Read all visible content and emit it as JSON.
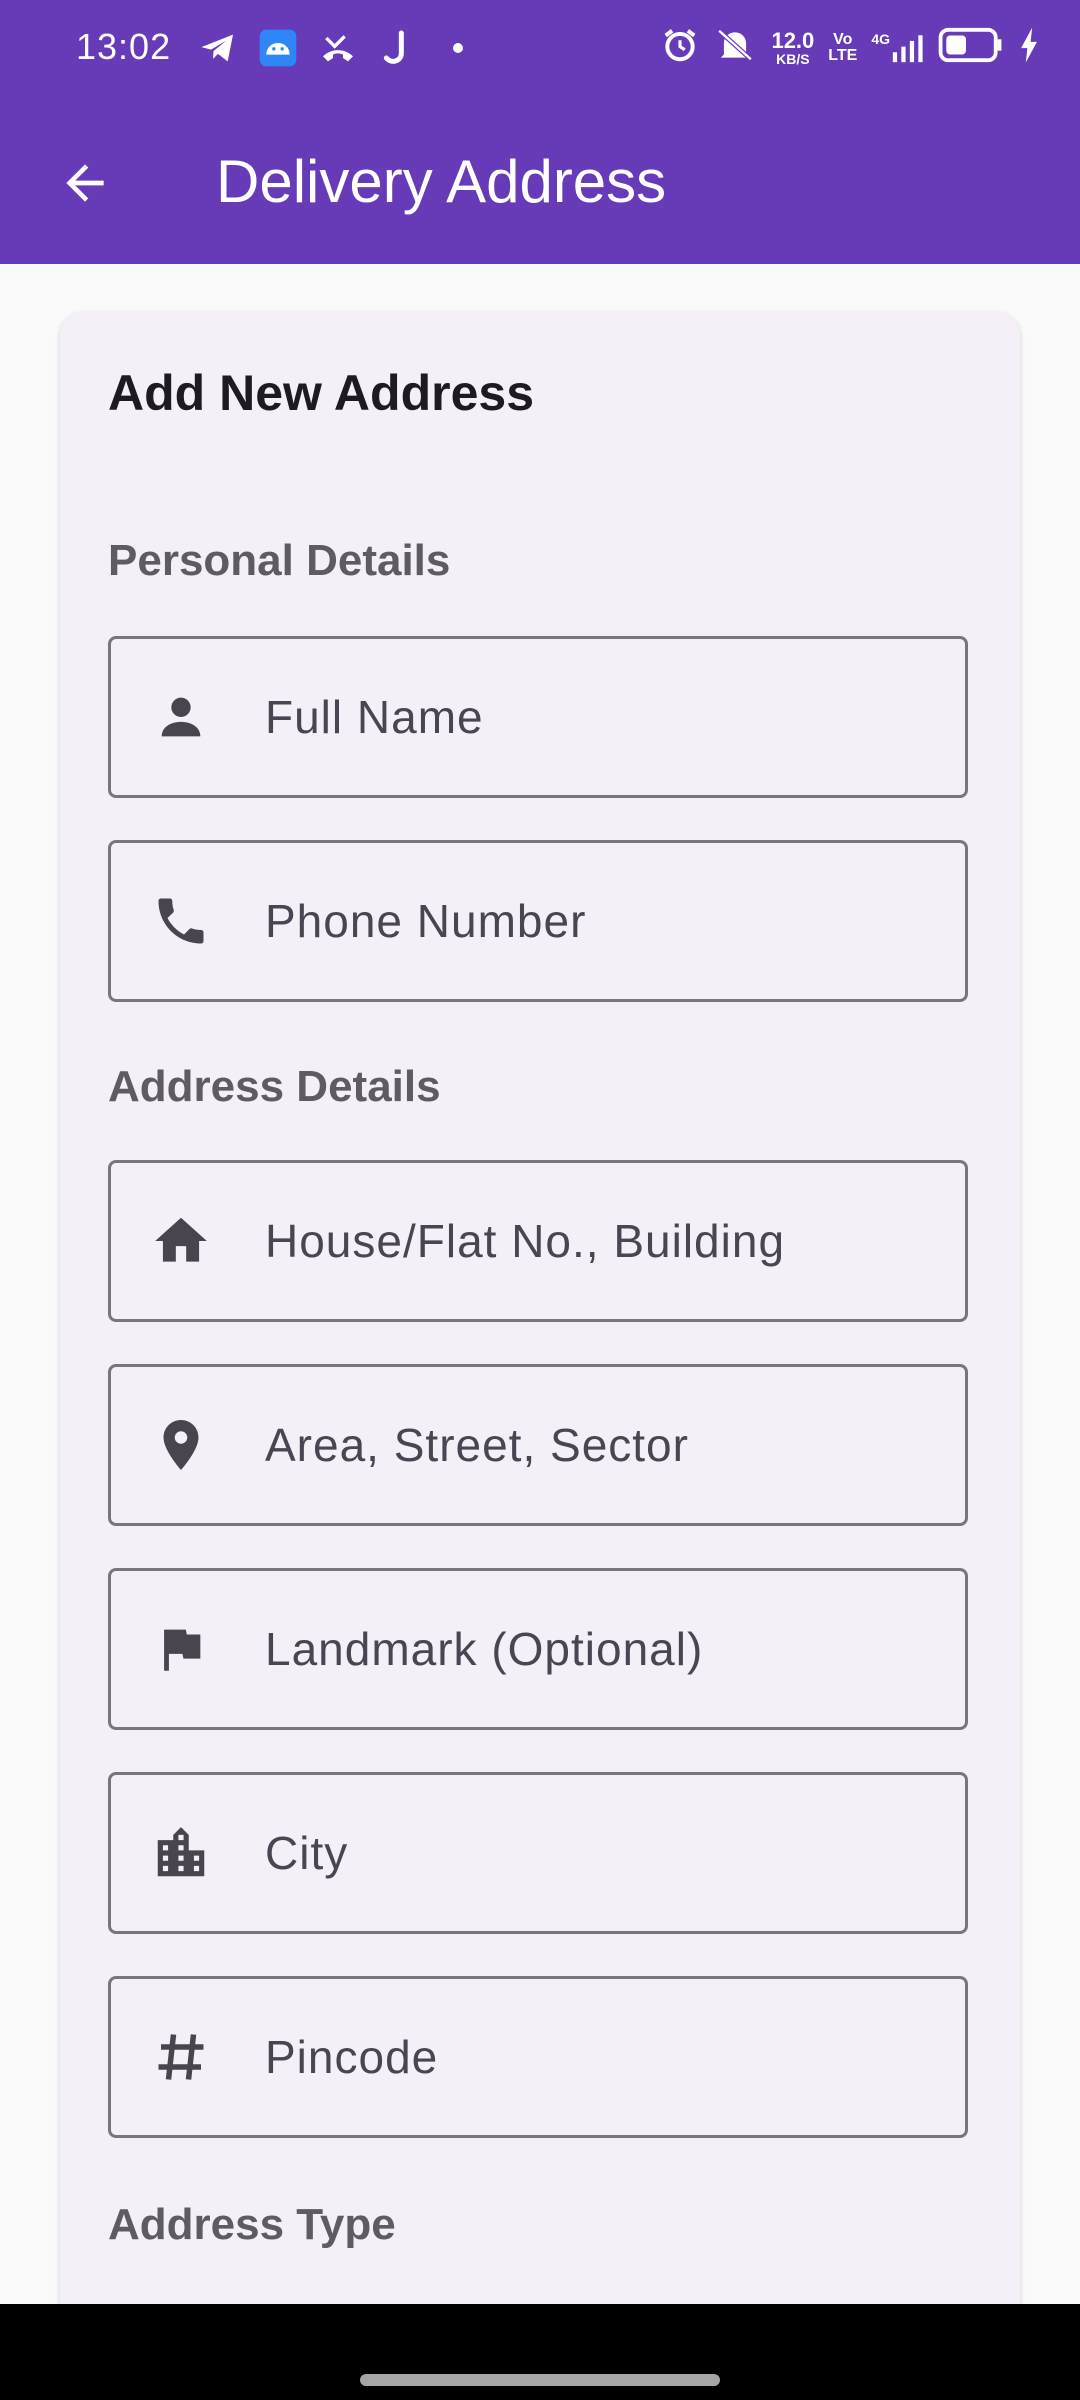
{
  "status_bar": {
    "time": "13:02",
    "network_speed_value": "12.0",
    "network_speed_unit": "KB/S",
    "volte_top": "Vo",
    "volte_bottom": "LTE",
    "network_type": "4G",
    "icons": [
      "telegram-icon",
      "android-icon",
      "missed-call-icon",
      "j-app-icon",
      "dot-icon",
      "alarm-icon",
      "mute-icon",
      "signal-icon",
      "battery-icon",
      "charging-icon"
    ],
    "battery_level": 0.45
  },
  "app_bar": {
    "title": "Delivery Address",
    "back_icon": "arrow-back-icon",
    "background": "#673ab7"
  },
  "card": {
    "title": "Add New Address",
    "sections": {
      "personal": "Personal Details",
      "address": "Address Details",
      "type": "Address Type"
    },
    "fields": {
      "full_name": {
        "placeholder": "Full Name",
        "icon": "person-icon"
      },
      "phone": {
        "placeholder": "Phone Number",
        "icon": "phone-icon"
      },
      "house": {
        "placeholder": "House/Flat No., Building",
        "icon": "home-icon"
      },
      "area": {
        "placeholder": "Area, Street, Sector",
        "icon": "location-pin-icon"
      },
      "landmark": {
        "placeholder": "Landmark (Optional)",
        "icon": "flag-icon"
      },
      "city": {
        "placeholder": "City",
        "icon": "city-icon"
      },
      "pincode": {
        "placeholder": "Pincode",
        "icon": "hash-icon"
      }
    }
  },
  "colors": {
    "accent": "#673ab7",
    "card_bg": "#f5eff7",
    "field_border": "#79747e",
    "chip_selected": "#e6ddf3"
  }
}
